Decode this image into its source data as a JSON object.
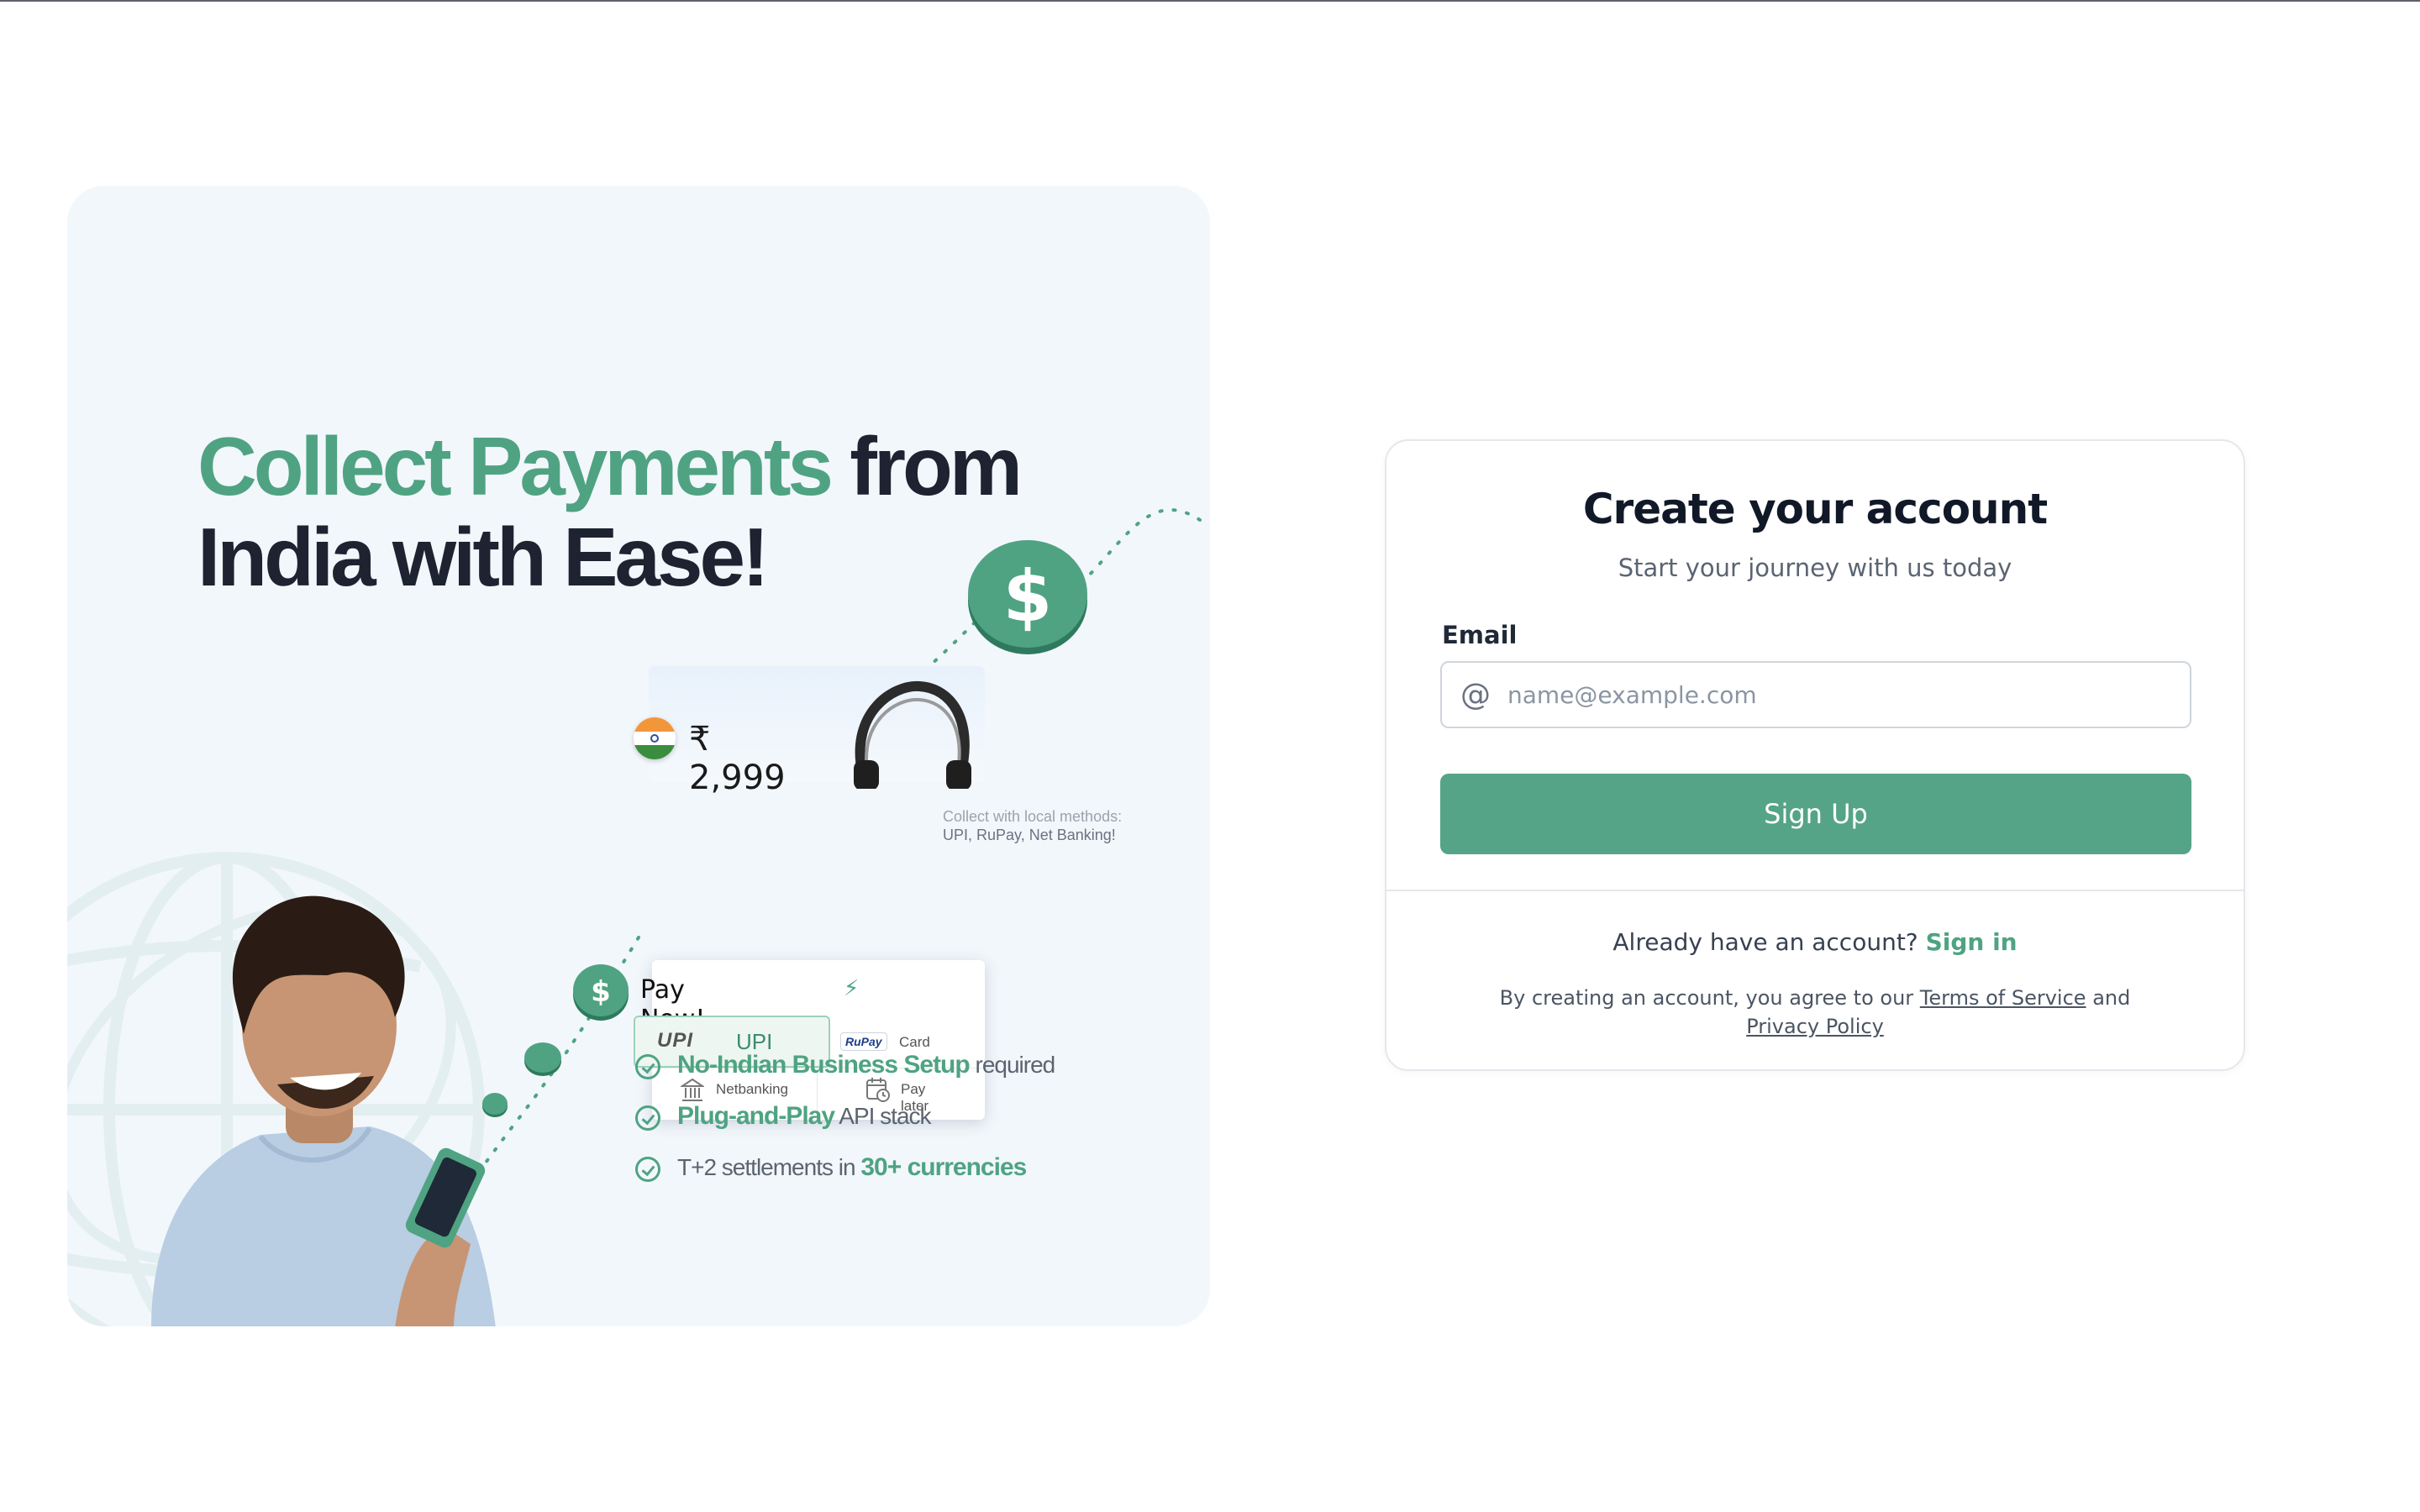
{
  "promo": {
    "headline_accent": "Collect Payments",
    "headline_rest_line1": " from",
    "headline_line2": "India with Ease!",
    "price": "₹ 2,999",
    "pay_now": "Pay Now!",
    "methods": {
      "upi_logo": "UPI",
      "upi": "UPI",
      "rupay": "RuPay",
      "card": "Card",
      "netbanking": "Netbanking",
      "pay_later": "Pay later"
    },
    "local_note_line1": "Collect with local methods:",
    "local_note_line2": "UPI, RuPay, Net Banking!",
    "features": [
      {
        "highlight": "No-Indian Business Setup",
        "text": " required"
      },
      {
        "highlight": "Plug-and-Play",
        "text": " API stack"
      },
      {
        "prefix": "T+2 settlements in ",
        "highlight": "30+ currencies"
      }
    ],
    "colors": {
      "accent": "#4fa382",
      "panel_bg": "#f2f7fb",
      "dark_text": "#1d2330"
    }
  },
  "signup": {
    "title": "Create your account",
    "subtitle": "Start your journey with us today",
    "email_label": "Email",
    "email_value": "",
    "email_placeholder": "name@example.com",
    "email_icon": "at-icon",
    "button": "Sign Up",
    "have_account": "Already have an account?",
    "sign_in": "Sign in",
    "legal_prefix": "By creating an account, you agree to our ",
    "terms": "Terms of Service",
    "legal_and": " and",
    "privacy": "Privacy Policy",
    "colors": {
      "button": "#55a488",
      "link": "#4fa382"
    }
  }
}
